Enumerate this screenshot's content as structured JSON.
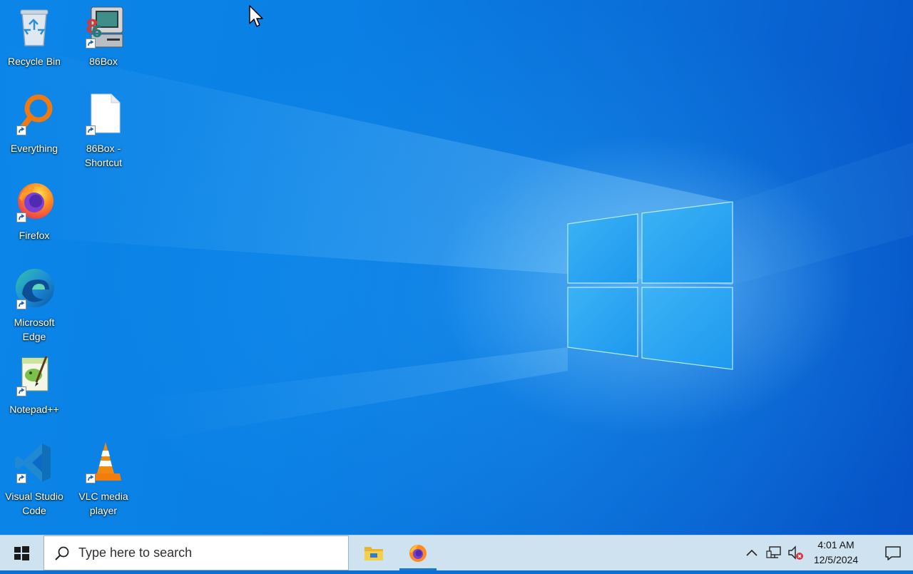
{
  "desktop": {
    "icons": [
      {
        "label": "Recycle Bin",
        "icon": "recycle-bin-icon"
      },
      {
        "label": "86Box",
        "icon": "86box-icon"
      },
      {
        "label": "Everything",
        "icon": "everything-search-icon"
      },
      {
        "label": "86Box - Shortcut",
        "icon": "blank-file-icon"
      },
      {
        "label": "Firefox",
        "icon": "firefox-icon"
      },
      {
        "label": "Microsoft Edge",
        "icon": "edge-icon"
      },
      {
        "label": "Notepad++",
        "icon": "notepadpp-icon"
      },
      {
        "label": "Visual Studio Code",
        "icon": "vscode-icon"
      },
      {
        "label": "VLC media player",
        "icon": "vlc-icon"
      }
    ]
  },
  "taskbar": {
    "search": {
      "placeholder": "Type here to search"
    },
    "pinned_apps": [
      {
        "name": "File Explorer",
        "icon": "file-explorer-icon",
        "active": false
      },
      {
        "name": "Firefox",
        "icon": "firefox-icon",
        "active": true
      }
    ],
    "tray": {
      "icons": [
        "chevron-up-icon",
        "network-icon",
        "volume-muted-icon"
      ],
      "time": "4:01 AM",
      "date": "12/5/2024"
    }
  },
  "colors": {
    "taskbar_bg": "#cfe2ef",
    "accent": "#1a76d2",
    "wallpaper": "#0a6fd6"
  }
}
